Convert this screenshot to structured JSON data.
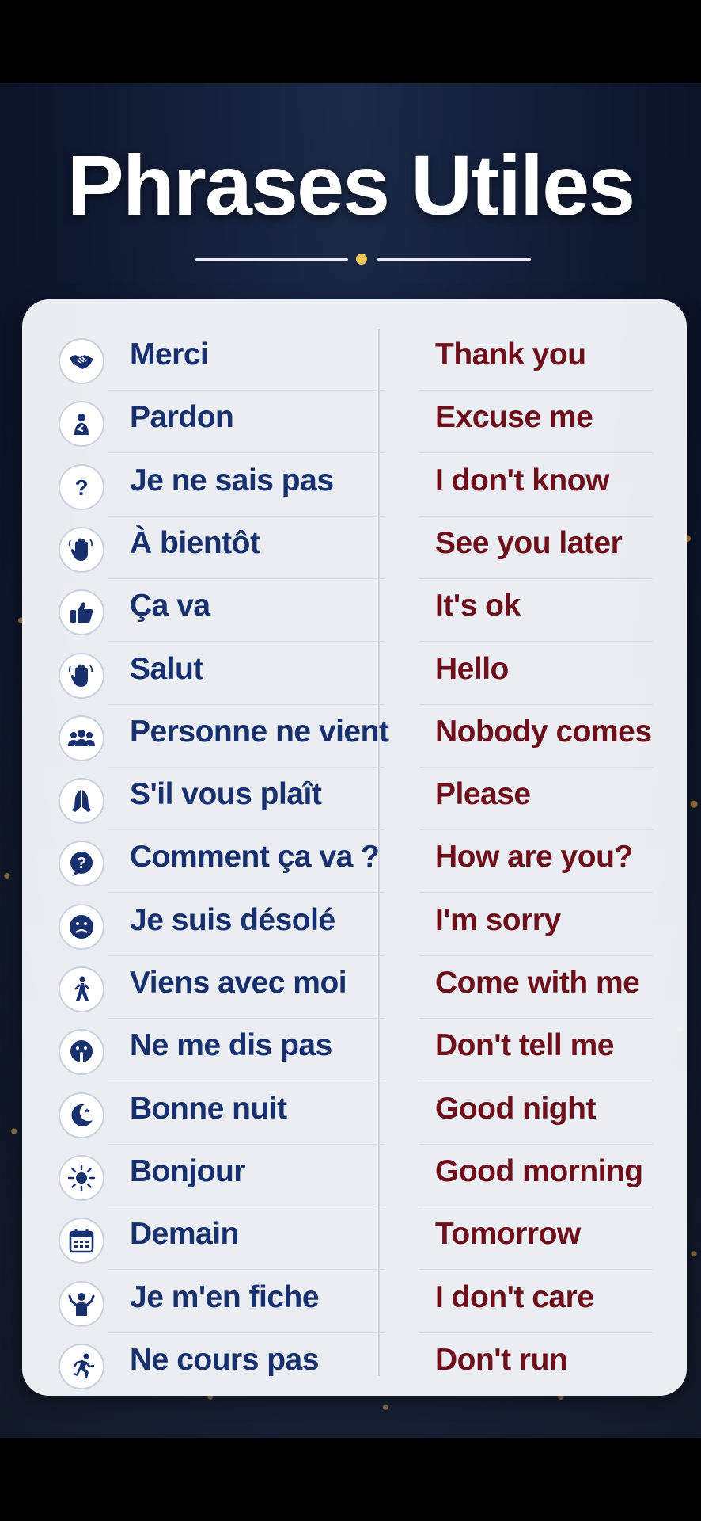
{
  "title": "Phrases Utiles",
  "colors": {
    "french_text": "#18316e",
    "english_text": "#6e0f1c",
    "accent_dot": "#f2c85a"
  },
  "phrases": [
    {
      "fr": "Merci",
      "en": "Thank you",
      "icon": "handshake-icon"
    },
    {
      "fr": "Pardon",
      "en": "Excuse me",
      "icon": "person-apology-icon"
    },
    {
      "fr": "Je ne sais pas",
      "en": "I don't know",
      "icon": "question-mark-icon"
    },
    {
      "fr": "À bientôt",
      "en": "See you later",
      "icon": "waving-hand-icon"
    },
    {
      "fr": "Ça va",
      "en": "It's ok",
      "icon": "thumbs-up-icon"
    },
    {
      "fr": "Salut",
      "en": "Hello",
      "icon": "waving-hand-icon"
    },
    {
      "fr": "Personne ne vient",
      "en": "Nobody comes",
      "icon": "group-icon"
    },
    {
      "fr": "S'il vous plaît",
      "en": "Please",
      "icon": "praying-hands-icon"
    },
    {
      "fr": "Comment ça va ?",
      "en": "How are you?",
      "icon": "question-bubble-icon"
    },
    {
      "fr": "Je suis désolé",
      "en": "I'm sorry",
      "icon": "sad-face-icon"
    },
    {
      "fr": "Viens avec moi",
      "en": "Come with me",
      "icon": "walking-person-icon"
    },
    {
      "fr": "Ne me dis pas",
      "en": "Don't tell me",
      "icon": "shush-face-icon"
    },
    {
      "fr": "Bonne nuit",
      "en": "Good night",
      "icon": "moon-icon"
    },
    {
      "fr": "Bonjour",
      "en": "Good morning",
      "icon": "sun-icon"
    },
    {
      "fr": "Demain",
      "en": "Tomorrow",
      "icon": "calendar-icon"
    },
    {
      "fr": "Je m'en fiche",
      "en": "I don't care",
      "icon": "shrug-icon"
    },
    {
      "fr": "Ne cours pas",
      "en": "Don't run",
      "icon": "running-person-icon"
    }
  ]
}
